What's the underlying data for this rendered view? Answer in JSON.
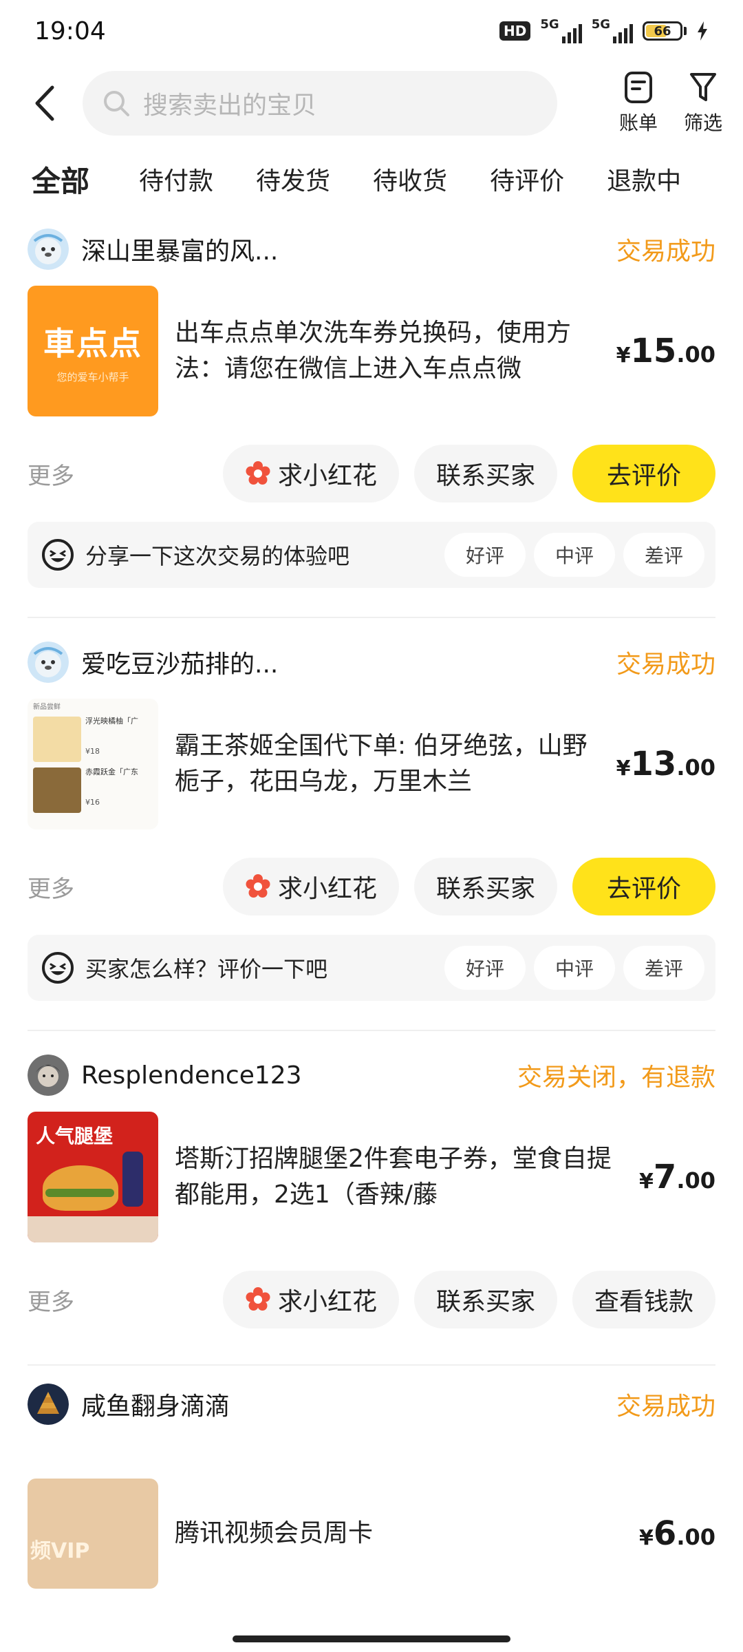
{
  "status_bar": {
    "time": "19:04",
    "hd": "HD",
    "net1": "5G",
    "net2": "5G",
    "battery": "66",
    "battery_level": 0.66
  },
  "search": {
    "placeholder": "搜索卖出的宝贝"
  },
  "top_actions": {
    "bill_label": "账单",
    "filter_label": "筛选"
  },
  "tabs": [
    {
      "label": "全部",
      "active": true
    },
    {
      "label": "待付款"
    },
    {
      "label": "待发货"
    },
    {
      "label": "待收货"
    },
    {
      "label": "待评价"
    },
    {
      "label": "退款中"
    }
  ],
  "orders": [
    {
      "buyer": "深山里暴富的风...",
      "status": "交易成功",
      "title": "出车点点单次洗车券兑换码，使用方法：请您在微信上进入车点点微",
      "thumb_text": "車点点",
      "thumb_sub": "您的爱车小帮手",
      "price_cur": "¥",
      "price_int": "15",
      "price_dec": ".00",
      "more": "更多",
      "btn_flower": "求小红花",
      "btn_contact": "联系买家",
      "btn_primary": "去评价",
      "feedback_text": "分享一下这次交易的体验吧",
      "rate_good": "好评",
      "rate_mid": "中评",
      "rate_bad": "差评"
    },
    {
      "buyer": "爱吃豆沙茄排的...",
      "status": "交易成功",
      "title": "霸王茶姬全国代下单: 伯牙绝弦，山野栀子，花田乌龙，万里木兰",
      "thumb_lines": [
        "新品尝鲜",
        "浮光映橘柚「广",
        "¥18",
        "赤霞跃金「广东",
        "¥16"
      ],
      "price_cur": "¥",
      "price_int": "13",
      "price_dec": ".00",
      "more": "更多",
      "btn_flower": "求小红花",
      "btn_contact": "联系买家",
      "btn_primary": "去评价",
      "feedback_text": "买家怎么样？评价一下吧",
      "rate_good": "好评",
      "rate_mid": "中评",
      "rate_bad": "差评"
    },
    {
      "buyer": "Resplendence123",
      "status": "交易关闭，有退款",
      "title": "塔斯汀招牌腿堡2件套电子券，堂食自提都能用，2选1（香辣/藤",
      "thumb_text": "人气腿堡",
      "price_cur": "¥",
      "price_int": "7",
      "price_dec": ".00",
      "more": "更多",
      "btn_flower": "求小红花",
      "btn_contact": "联系买家",
      "btn_secondary": "查看钱款"
    },
    {
      "buyer": "咸鱼翻身滴滴",
      "status": "交易成功",
      "title": "腾讯视频会员周卡",
      "thumb_text": "频VIP",
      "price_cur": "¥",
      "price_int": "6",
      "price_dec": ".00"
    }
  ],
  "colors": {
    "accent_yellow": "#ffe21a",
    "status_orange": "#f29a1a"
  }
}
